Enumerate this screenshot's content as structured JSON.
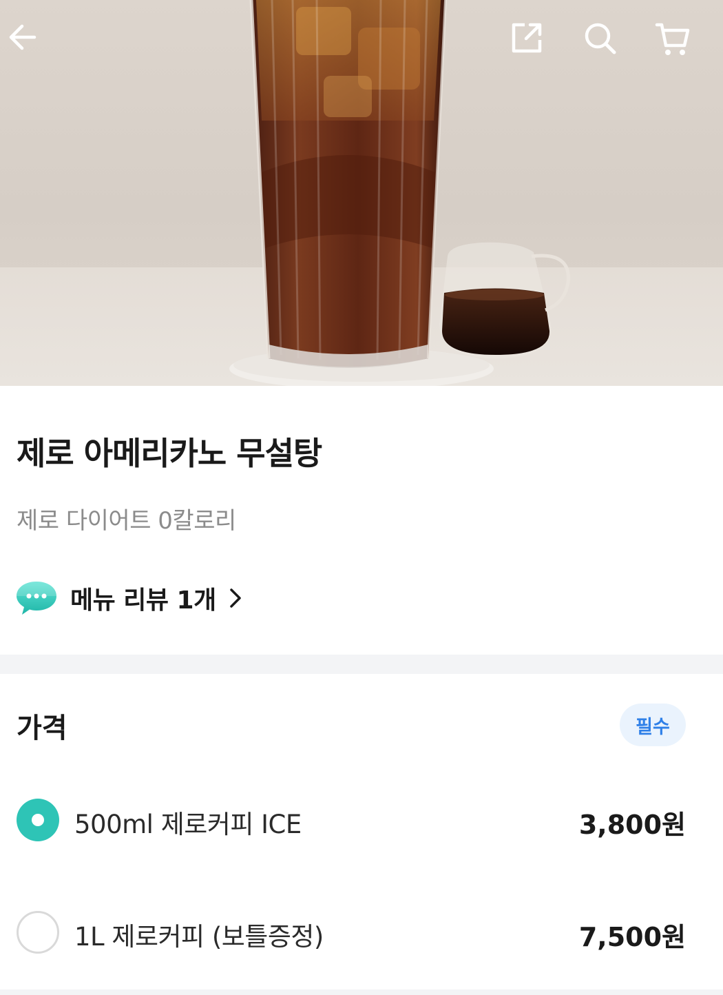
{
  "product": {
    "title": "제로 아메리카노 무설탕",
    "subtitle": "제로 다이어트 0칼로리",
    "review_link": "메뉴 리뷰 1개"
  },
  "price_section": {
    "title": "가격",
    "badge": "필수",
    "options": [
      {
        "name": "500ml 제로커피 ICE",
        "price": "3,800원",
        "selected": true
      },
      {
        "name": "1L 제로커피 (보틀증정)",
        "price": "7,500원",
        "selected": false
      }
    ]
  },
  "colors": {
    "accent": "#2ec4b6",
    "badge_text": "#2f80e8",
    "badge_bg": "#eaf3fd",
    "subtitle": "#8b8b8b"
  },
  "icons": [
    "back-arrow-icon",
    "share-icon",
    "search-icon",
    "cart-icon",
    "chat-bubble-icon",
    "chevron-right-icon",
    "radio-icon"
  ]
}
